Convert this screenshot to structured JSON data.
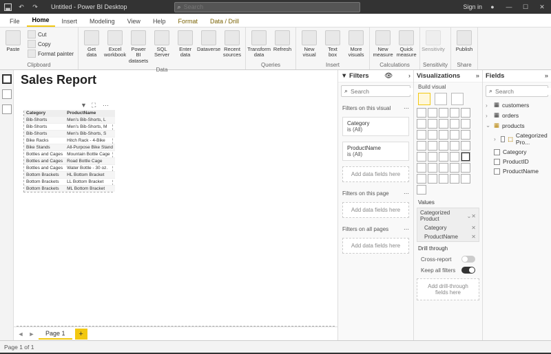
{
  "titlebar": {
    "title": "Untitled - Power BI Desktop",
    "search_placeholder": "Search",
    "signin": "Sign in"
  },
  "tabs": {
    "file": "File",
    "home": "Home",
    "insert": "Insert",
    "modeling": "Modeling",
    "view": "View",
    "help": "Help",
    "format": "Format",
    "data_drill": "Data / Drill"
  },
  "ribbon": {
    "clipboard": {
      "label": "Clipboard",
      "paste": "Paste",
      "cut": "Cut",
      "copy": "Copy",
      "format_painter": "Format painter"
    },
    "data": {
      "label": "Data",
      "get_data": "Get data",
      "excel": "Excel workbook",
      "pbi": "Power BI datasets",
      "sql": "SQL Server",
      "enter": "Enter data",
      "dataverse": "Dataverse",
      "recent": "Recent sources"
    },
    "queries": {
      "label": "Queries",
      "transform": "Transform data",
      "refresh": "Refresh"
    },
    "insert": {
      "label": "Insert",
      "new_visual": "New visual",
      "text_box": "Text box",
      "more": "More visuals"
    },
    "calc": {
      "label": "Calculations",
      "nm": "New measure",
      "qm": "Quick measure"
    },
    "sens": {
      "label": "Sensitivity",
      "s": "Sensitivity"
    },
    "share": {
      "label": "Share",
      "p": "Publish"
    }
  },
  "report_title": "Sales Report",
  "table": {
    "cols": [
      "Category",
      "ProductName"
    ],
    "rows": [
      [
        "Bib-Shorts",
        "Men's Bib-Shorts, L"
      ],
      [
        "Bib-Shorts",
        "Men's Bib-Shorts, M"
      ],
      [
        "Bib-Shorts",
        "Men's Bib-Shorts, S"
      ],
      [
        "Bike Racks",
        "Hitch Rack - 4-Bike"
      ],
      [
        "Bike Stands",
        "All-Purpose Bike Stand"
      ],
      [
        "Bottles and Cages",
        "Mountain Bottle Cage"
      ],
      [
        "Bottles and Cages",
        "Road Bottle Cage"
      ],
      [
        "Bottles and Cages",
        "Water Bottle - 30 oz."
      ],
      [
        "Bottom Brackets",
        "HL Bottom Bracket"
      ],
      [
        "Bottom Brackets",
        "LL Bottom Bracket"
      ],
      [
        "Bottom Brackets",
        "ML Bottom Bracket"
      ]
    ]
  },
  "page": {
    "tab": "Page 1",
    "status": "Page 1 of 1"
  },
  "filters": {
    "title": "Filters",
    "search_placeholder": "Search",
    "visual_head": "Filters on this visual",
    "category": "Category",
    "is_all": "is (All)",
    "product": "ProductName",
    "add_here": "Add data fields here",
    "page_head": "Filters on this page",
    "all_head": "Filters on all pages"
  },
  "viz": {
    "title": "Visualizations",
    "build": "Build visual",
    "values": "Values",
    "well_head": "Categorized Product",
    "well_cat": "Category",
    "well_prod": "ProductName",
    "drill": "Drill through",
    "cross": "Cross-report",
    "keep": "Keep all filters",
    "drill_add": "Add drill-through fields here"
  },
  "fields": {
    "title": "Fields",
    "search_placeholder": "Search",
    "customers": "customers",
    "orders": "orders",
    "products": "products",
    "categorized": "Categorized Pro...",
    "category": "Category",
    "productid": "ProductID",
    "productname": "ProductName"
  }
}
